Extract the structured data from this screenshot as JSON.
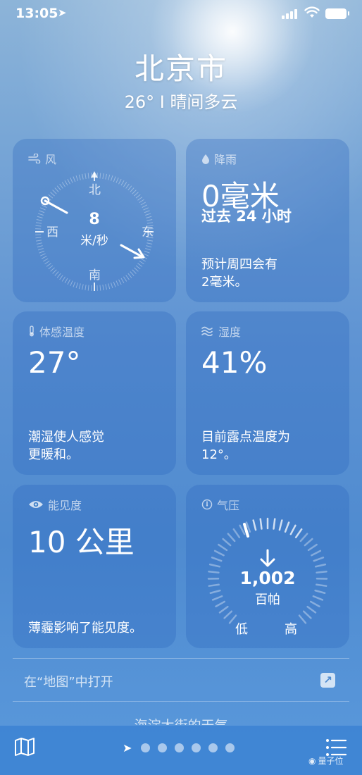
{
  "status_bar": {
    "time": "13:05"
  },
  "header": {
    "city": "北京市",
    "summary": "26° I 晴间多云"
  },
  "cards": {
    "wind": {
      "title": "风",
      "speed": "8",
      "unit": "米/秒",
      "directions": {
        "north": "北",
        "south": "南",
        "east": "东",
        "west": "西"
      }
    },
    "rain": {
      "title": "降雨",
      "value": "0毫米",
      "period": "过去 24 小时",
      "desc_line1": "预计周四会有",
      "desc_line2": "2毫米。"
    },
    "feels_like": {
      "title": "体感温度",
      "value": "27°",
      "desc_line1": "潮湿使人感觉",
      "desc_line2": "更暖和。"
    },
    "humidity": {
      "title": "湿度",
      "value": "41%",
      "desc_line1": "目前露点温度为",
      "desc_line2": "12°。"
    },
    "visibility": {
      "title": "能见度",
      "value": "10 公里",
      "desc": "薄霾影响了能见度。"
    },
    "pressure": {
      "title": "气压",
      "value": "1,002",
      "unit": "百帕",
      "low_label": "低",
      "high_label": "高"
    }
  },
  "map_link": {
    "label": "在“地图”中打开"
  },
  "next_location_title": "海淀大街的天气",
  "watermark": "量子位",
  "icons": {
    "wind": "wind-icon",
    "rain": "raindrop-icon",
    "thermometer": "thermometer-icon",
    "humidity": "humidity-icon",
    "eye": "eye-icon",
    "gauge": "gauge-icon",
    "map": "map-icon",
    "list": "list-icon",
    "location": "location-arrow-icon"
  }
}
